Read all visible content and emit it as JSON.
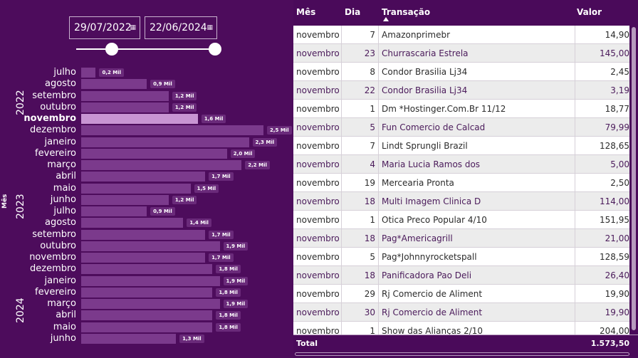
{
  "filters": {
    "start_date": "29/07/2022",
    "end_date": "22/06/2024",
    "calendar_icon": "calendar-icon"
  },
  "chart_data": {
    "type": "bar",
    "orientation": "horizontal",
    "ylabel": "Mês",
    "years": [
      {
        "label": "2022",
        "from": 0,
        "to": 5
      },
      {
        "label": "2023",
        "from": 6,
        "to": 17
      },
      {
        "label": "2024",
        "from": 18,
        "to": 23
      }
    ],
    "categories": [
      "julho",
      "agosto",
      "setembro",
      "outubro",
      "novembro",
      "dezembro",
      "janeiro",
      "fevereiro",
      "março",
      "abril",
      "maio",
      "junho",
      "julho",
      "agosto",
      "setembro",
      "outubro",
      "novembro",
      "dezembro",
      "janeiro",
      "fevereiro",
      "março",
      "abril",
      "maio",
      "junho"
    ],
    "values": [
      0.2,
      0.9,
      1.2,
      1.2,
      1.6,
      2.5,
      2.3,
      2.0,
      2.2,
      1.7,
      1.5,
      1.2,
      0.9,
      1.4,
      1.7,
      1.9,
      1.7,
      1.8,
      1.9,
      1.8,
      1.9,
      1.8,
      1.8,
      1.3
    ],
    "data_labels": [
      "0,2 Mil",
      "0,9 Mil",
      "1,2 Mil",
      "1,2 Mil",
      "1,6 Mil",
      "2,5 Mil",
      "2,3 Mil",
      "2,0 Mil",
      "2,2 Mil",
      "1,7 Mil",
      "1,5 Mil",
      "1,2 Mil",
      "0,9 Mil",
      "1,4 Mil",
      "1,7 Mil",
      "1,9 Mil",
      "1,7 Mil",
      "1,8 Mil",
      "1,9 Mil",
      "1,8 Mil",
      "1,9 Mil",
      "1,8 Mil",
      "1,8 Mil",
      "1,3 Mil"
    ],
    "highlighted_index": 4,
    "xlim": [
      0,
      2.5
    ]
  },
  "table": {
    "headers": {
      "mes": "Mês",
      "dia": "Dia",
      "transacao": "Transação",
      "valor": "Valor"
    },
    "rows": [
      {
        "mes": "novembro",
        "dia": "7",
        "transacao": "Amazonprimebr",
        "valor": "14,90"
      },
      {
        "mes": "novembro",
        "dia": "23",
        "transacao": "Churrascaria Estrela",
        "valor": "145,00"
      },
      {
        "mes": "novembro",
        "dia": "8",
        "transacao": "Condor Brasilia Lj34",
        "valor": "2,45"
      },
      {
        "mes": "novembro",
        "dia": "22",
        "transacao": "Condor Brasilia Lj34",
        "valor": "3,19"
      },
      {
        "mes": "novembro",
        "dia": "1",
        "transacao": "Dm *Hostinger.Com.Br 11/12",
        "valor": "18,77"
      },
      {
        "mes": "novembro",
        "dia": "5",
        "transacao": "Fun Comercio de Calcad",
        "valor": "79,99"
      },
      {
        "mes": "novembro",
        "dia": "7",
        "transacao": "Lindt Sprungli Brazil",
        "valor": "128,65"
      },
      {
        "mes": "novembro",
        "dia": "4",
        "transacao": "Maria Lucia Ramos dos",
        "valor": "5,00"
      },
      {
        "mes": "novembro",
        "dia": "19",
        "transacao": "Mercearia Pronta",
        "valor": "2,50"
      },
      {
        "mes": "novembro",
        "dia": "18",
        "transacao": "Multi Imagem Clinica D",
        "valor": "114,00"
      },
      {
        "mes": "novembro",
        "dia": "1",
        "transacao": "Otica Preco Popular 4/10",
        "valor": "151,95"
      },
      {
        "mes": "novembro",
        "dia": "18",
        "transacao": "Pag*Americagrill",
        "valor": "21,00"
      },
      {
        "mes": "novembro",
        "dia": "5",
        "transacao": "Pag*Johnnyrocketspall",
        "valor": "128,59"
      },
      {
        "mes": "novembro",
        "dia": "18",
        "transacao": "Panificadora Pao Deli",
        "valor": "26,40"
      },
      {
        "mes": "novembro",
        "dia": "29",
        "transacao": "Rj Comercio de Aliment",
        "valor": "19,90"
      },
      {
        "mes": "novembro",
        "dia": "30",
        "transacao": "Rj Comercio de Aliment",
        "valor": "19,90"
      },
      {
        "mes": "novembro",
        "dia": "1",
        "transacao": "Show das Alianças 2/10",
        "valor": "204,00"
      }
    ],
    "total_label": "Total",
    "total_value": "1.573,50"
  }
}
